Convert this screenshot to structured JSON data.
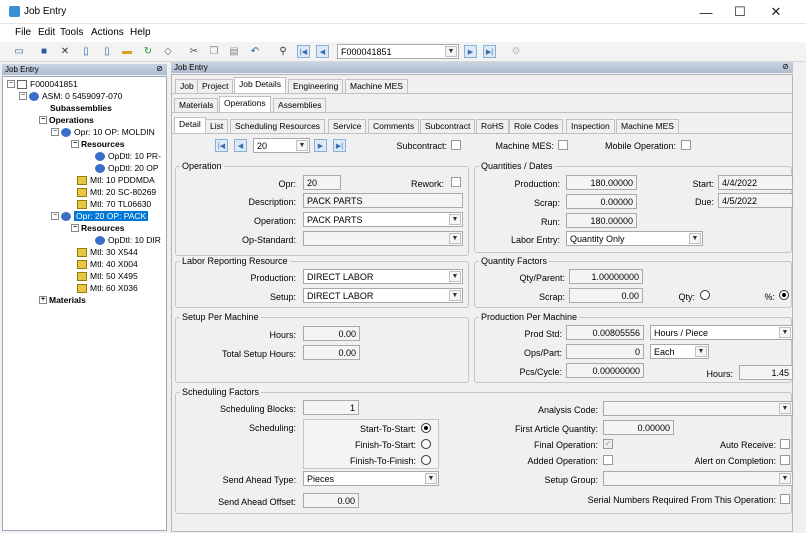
{
  "window": {
    "title": "Job Entry",
    "minimize": "—",
    "maximize": "☐",
    "close": "✕"
  },
  "menu": [
    "File",
    "Edit",
    "Tools",
    "Actions",
    "Help"
  ],
  "toolbar": {
    "job_value": "F000041851"
  },
  "tree_panel": {
    "title": "Job Entry",
    "nodes": [
      "F000041851",
      "ASM: 0 5459097-070",
      "Subassemblies",
      "Operations",
      "Opr: 10 OP: MOLDIN",
      "Resources",
      "OpDtl: 10 PR-",
      "OpDtl: 20 OP",
      "Mtl: 10 PDDMDA",
      "Mtl: 20 SC-80269",
      "Mtl: 70 TL06630",
      "Opr: 20 OP: PACK",
      "Resources",
      "OpDtl: 10 DIR",
      "Mtl: 30 X544",
      "Mtl: 40 X004",
      "Mtl: 50 X495",
      "Mtl: 60 X036",
      "Materials"
    ]
  },
  "main_panel": {
    "title": "Job Entry"
  },
  "tabs1": [
    "Job",
    "Project",
    "Job Details",
    "Engineering",
    "Machine MES"
  ],
  "tabs2": [
    "Materials",
    "Operations",
    "Assemblies"
  ],
  "tabs3": [
    "Detail",
    "List",
    "Scheduling Resources",
    "Service",
    "Comments",
    "Subcontract",
    "RoHS",
    "Role Codes",
    "Inspection",
    "Machine MES"
  ],
  "nav": {
    "value": "20",
    "subcontract": "Subcontract:",
    "machine_mes": "Machine MES:",
    "mobile_operation": "Mobile Operation:"
  },
  "operation": {
    "title": "Operation",
    "opr_label": "Opr:",
    "opr": "20",
    "rework_label": "Rework:",
    "desc_label": "Description:",
    "desc": "PACK PARTS",
    "op_label": "Operation:",
    "op": "PACK PARTS",
    "std_label": "Op-Standard:",
    "std": ""
  },
  "labor": {
    "title": "Labor Reporting Resource",
    "prod_label": "Production:",
    "prod": "DIRECT LABOR",
    "setup_label": "Setup:",
    "setup": "DIRECT LABOR"
  },
  "setup_machine": {
    "title": "Setup Per Machine",
    "hours_label": "Hours:",
    "hours": "0.00",
    "total_label": "Total Setup Hours:",
    "total": "0.00"
  },
  "qty_dates": {
    "title": "Quantities / Dates",
    "prod_label": "Production:",
    "prod": "180.00000",
    "scrap_label": "Scrap:",
    "scrap": "0.00000",
    "run_label": "Run:",
    "run": "180.00000",
    "labor_label": "Labor Entry:",
    "labor": "Quantity Only",
    "start_label": "Start:",
    "start": "4/4/2022",
    "due_label": "Due:",
    "due": "4/5/2022"
  },
  "qty_factors": {
    "title": "Quantity Factors",
    "qp_label": "Qty/Parent:",
    "qp": "1.00000000",
    "scrap_label": "Scrap:",
    "scrap": "0.00",
    "qty_label": "Qty:",
    "pct_label": "%:"
  },
  "prod_machine": {
    "title": "Production Per Machine",
    "std_label": "Prod Std:",
    "std": "0.00805556",
    "std_unit": "Hours / Piece",
    "ops_label": "Ops/Part:",
    "ops": "0",
    "ops_unit": "Each",
    "pcs_label": "Pcs/Cycle:",
    "pcs": "0.00000000",
    "hours_label": "Hours:",
    "hours": "1.45"
  },
  "sched": {
    "title": "Scheduling Factors",
    "blocks_label": "Scheduling Blocks:",
    "blocks": "1",
    "sched_label": "Scheduling:",
    "s2s": "Start-To-Start:",
    "f2s": "Finish-To-Start:",
    "f2f": "Finish-To-Finish:",
    "sat_label": "Send Ahead Type:",
    "sat": "Pieces",
    "sao_label": "Send Ahead Offset:",
    "sao": "0.00",
    "analysis_label": "Analysis Code:",
    "faq_label": "First Article Quantity:",
    "faq": "0.00000",
    "final_label": "Final Operation:",
    "auto_label": "Auto Receive:",
    "added_label": "Added Operation:",
    "alert_label": "Alert on Completion:",
    "sg_label": "Setup Group:",
    "serial_label": "Serial Numbers Required From This Operation:"
  }
}
